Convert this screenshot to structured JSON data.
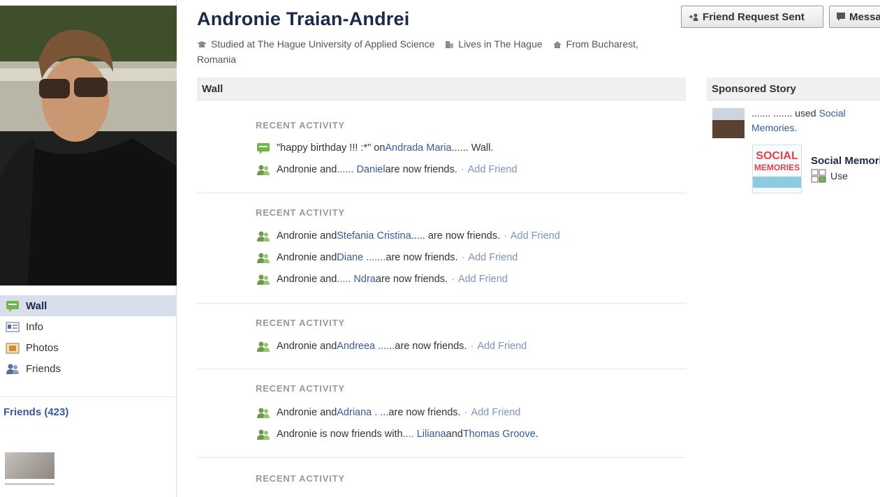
{
  "profile": {
    "name": "Andronie Traian-Andrei",
    "studied": "Studied at The Hague University of Applied Science",
    "lives": "Lives in The Hague",
    "from": "From Bucharest, Romania"
  },
  "header_buttons": {
    "friend_request": "Friend Request Sent",
    "message": "Message"
  },
  "left_nav": {
    "items": [
      {
        "label": "Wall",
        "icon": "wall-icon"
      },
      {
        "label": "Info",
        "icon": "info-icon"
      },
      {
        "label": "Photos",
        "icon": "photos-icon"
      },
      {
        "label": "Friends",
        "icon": "friends-icon"
      }
    ],
    "friends_title": "Friends (423)"
  },
  "wall": {
    "title": "Wall",
    "recent_label": "RECENT ACTIVITY",
    "add_friend": "Add Friend",
    "groups": [
      {
        "rows": [
          {
            "type": "comment",
            "pre": "\"happy birthday !!! :*\" on ",
            "link": "Andrada Maria",
            "post": " ...... Wall.",
            "add": false
          },
          {
            "type": "friend",
            "pre": "Andronie and ",
            "link": "...... Daniel",
            "post": " are now friends.",
            "add": true
          }
        ]
      },
      {
        "rows": [
          {
            "type": "friend",
            "pre": "Andronie and ",
            "link": "Stefania Cristina",
            "post": " ..... are now friends.",
            "add": true
          },
          {
            "type": "friend",
            "pre": "Andronie and ",
            "link": "Diane .......",
            "post": " are now friends.",
            "add": true
          },
          {
            "type": "friend",
            "pre": "Andronie and ",
            "link": "..... Ndra",
            "post": " are now friends.",
            "add": true
          }
        ]
      },
      {
        "rows": [
          {
            "type": "friend",
            "pre": "Andronie and ",
            "link": "Andreea ......",
            "post": " are now friends.",
            "add": true
          }
        ]
      },
      {
        "rows": [
          {
            "type": "friend",
            "pre": "Andronie and ",
            "link": "Adriana . ...",
            "post": " are now friends.",
            "add": true
          },
          {
            "type": "friend",
            "pre": "Andronie is now friends with ",
            "link": ".... Liliana",
            "post": " and ",
            "link2": "Thomas Groove",
            "post2": ".",
            "add": false
          }
        ]
      },
      {
        "rows": []
      }
    ]
  },
  "sponsored": {
    "title": "Sponsored Story",
    "text_pre": "....... ....... used ",
    "text_link": "Social Memories",
    "text_post": ".",
    "logo_line1": "SOCIAL",
    "logo_line2": "MEMORIES",
    "app_name": "Social Memories",
    "use_label": "Use"
  },
  "colors": {
    "link": "#3b5998",
    "header_text": "#1c2a47",
    "nav_active_bg": "#d8dfea",
    "muted": "#999999",
    "add_friend": "#7f93bc"
  }
}
